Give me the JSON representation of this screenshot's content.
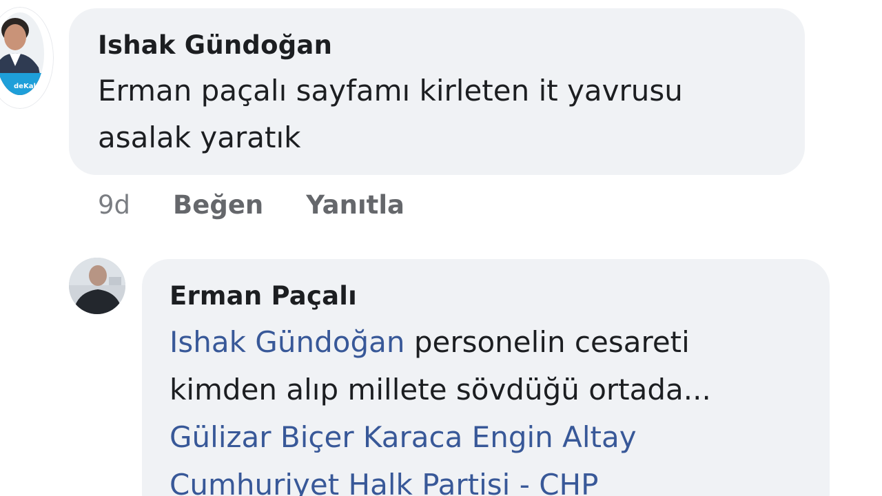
{
  "comment1": {
    "author": "Ishak Gündoğan",
    "text_line1": "Erman paçalı sayfamı kirleten it yavrusu",
    "text_line2": "asalak yaratık",
    "time": "9d",
    "like_label": "Beğen",
    "reply_label": "Yanıtla",
    "avatar_badge_text": "deKal"
  },
  "comment2": {
    "author": "Erman Paçalı",
    "mention_1": "Ishak Gündoğan",
    "text_after_mention_1": " personelin cesareti",
    "text_line2": "kimden alıp millete sövdüğü ortada...",
    "mention_2": "Gülizar Biçer Karaca",
    "mention_3": "Engin Altay",
    "mention_4": "Cumhuriyet Halk Partisi - CHP"
  },
  "colors": {
    "bubble_bg": "#f0f2f5",
    "text": "#1c1e21",
    "mention_link": "#385898",
    "meta_text": "#65676b",
    "avatar_badge": "#1e9fd9"
  }
}
